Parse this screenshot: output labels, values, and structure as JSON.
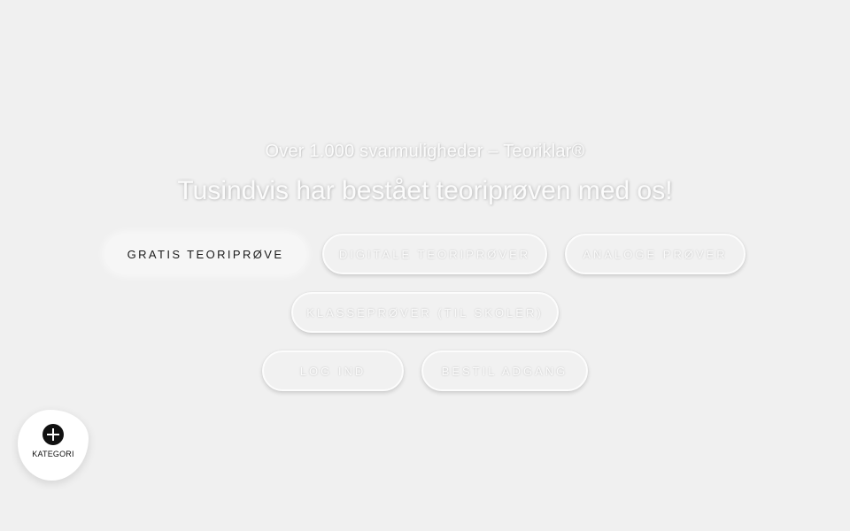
{
  "hero": {
    "subtitle": "Over 1.000 svarmuligheder – Teoriklar®",
    "headline": "Tusindvis har bestået teoriprøven med os!"
  },
  "buttons": {
    "free_test": "GRATIS TEORIPRØVE",
    "digital_test": "DIGITALE TEORIPRØVER",
    "analog_test": "ANALOGE PRØVER",
    "class_tests": "KLASSEPRØVER (TIL SKOLER)",
    "login": "LOG IND",
    "get_access": "BESTIL ADGANG"
  },
  "fab": {
    "label": "KATEGORI",
    "icon": "plus-circle-icon"
  }
}
